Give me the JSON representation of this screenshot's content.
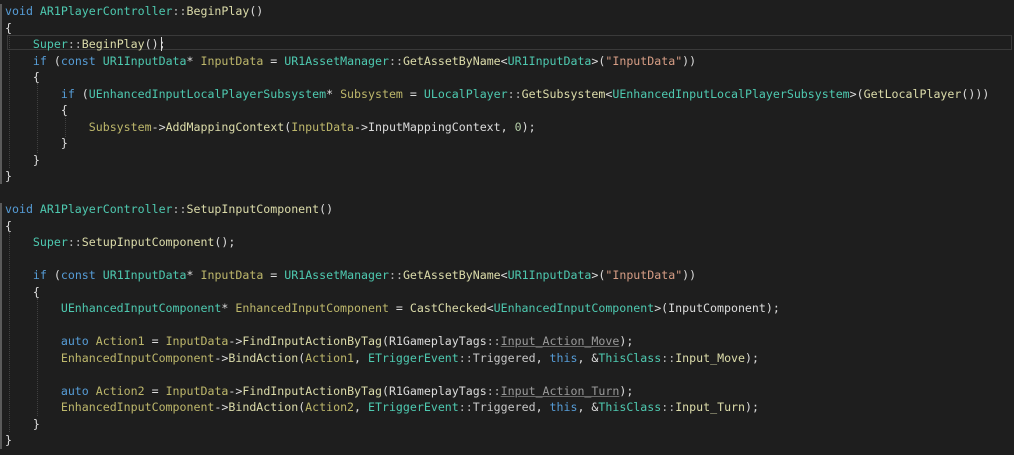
{
  "editor": {
    "lines": [
      [
        {
          "t": "void ",
          "c": "kw"
        },
        {
          "t": "AR1PlayerController",
          "c": "ty"
        },
        {
          "t": "::",
          "c": "op"
        },
        {
          "t": "BeginPlay",
          "c": "fn"
        },
        {
          "t": "()",
          "c": "tx"
        }
      ],
      [
        {
          "t": "{",
          "c": "tx"
        }
      ],
      [
        {
          "t": "    ",
          "c": "tx"
        },
        {
          "t": "Super",
          "c": "ty"
        },
        {
          "t": "::",
          "c": "op"
        },
        {
          "t": "BeginPlay",
          "c": "fn"
        },
        {
          "t": "();",
          "c": "tx"
        }
      ],
      [
        {
          "t": "    ",
          "c": "tx"
        },
        {
          "t": "if",
          "c": "kw"
        },
        {
          "t": " (",
          "c": "tx"
        },
        {
          "t": "const ",
          "c": "kw"
        },
        {
          "t": "UR1InputData",
          "c": "ty"
        },
        {
          "t": "* ",
          "c": "tx"
        },
        {
          "t": "InputData",
          "c": "ps"
        },
        {
          "t": " = ",
          "c": "tx"
        },
        {
          "t": "UR1AssetManager",
          "c": "ty"
        },
        {
          "t": "::",
          "c": "op"
        },
        {
          "t": "GetAssetByName",
          "c": "fn"
        },
        {
          "t": "<",
          "c": "tx"
        },
        {
          "t": "UR1InputData",
          "c": "ty"
        },
        {
          "t": ">(",
          "c": "tx"
        },
        {
          "t": "\"InputData\"",
          "c": "st"
        },
        {
          "t": "))",
          "c": "tx"
        }
      ],
      [
        {
          "t": "    {",
          "c": "tx"
        }
      ],
      [
        {
          "t": "        ",
          "c": "tx"
        },
        {
          "t": "if",
          "c": "kw"
        },
        {
          "t": " (",
          "c": "tx"
        },
        {
          "t": "UEnhancedInputLocalPlayerSubsystem",
          "c": "ty"
        },
        {
          "t": "* ",
          "c": "tx"
        },
        {
          "t": "Subsystem",
          "c": "ps"
        },
        {
          "t": " = ",
          "c": "tx"
        },
        {
          "t": "ULocalPlayer",
          "c": "ty"
        },
        {
          "t": "::",
          "c": "op"
        },
        {
          "t": "GetSubsystem",
          "c": "fn"
        },
        {
          "t": "<",
          "c": "tx"
        },
        {
          "t": "UEnhancedInputLocalPlayerSubsystem",
          "c": "ty"
        },
        {
          "t": ">(",
          "c": "tx"
        },
        {
          "t": "GetLocalPlayer",
          "c": "fn"
        },
        {
          "t": "()))",
          "c": "tx"
        }
      ],
      [
        {
          "t": "        {",
          "c": "tx"
        }
      ],
      [
        {
          "t": "            ",
          "c": "tx"
        },
        {
          "t": "Subsystem",
          "c": "ps"
        },
        {
          "t": "->",
          "c": "tx"
        },
        {
          "t": "AddMappingContext",
          "c": "fn"
        },
        {
          "t": "(",
          "c": "tx"
        },
        {
          "t": "InputData",
          "c": "ps"
        },
        {
          "t": "->",
          "c": "tx"
        },
        {
          "t": "InputMappingContext",
          "c": "tx"
        },
        {
          "t": ", ",
          "c": "tx"
        },
        {
          "t": "0",
          "c": "nm"
        },
        {
          "t": ");",
          "c": "tx"
        }
      ],
      [
        {
          "t": "        }",
          "c": "tx"
        }
      ],
      [
        {
          "t": "    }",
          "c": "tx"
        }
      ],
      [
        {
          "t": "}",
          "c": "tx"
        }
      ],
      [],
      [
        {
          "t": "void ",
          "c": "kw"
        },
        {
          "t": "AR1PlayerController",
          "c": "ty"
        },
        {
          "t": "::",
          "c": "op"
        },
        {
          "t": "SetupInputComponent",
          "c": "fn"
        },
        {
          "t": "()",
          "c": "tx"
        }
      ],
      [
        {
          "t": "{",
          "c": "tx"
        }
      ],
      [
        {
          "t": "    ",
          "c": "tx"
        },
        {
          "t": "Super",
          "c": "ty"
        },
        {
          "t": "::",
          "c": "op"
        },
        {
          "t": "SetupInputComponent",
          "c": "fn"
        },
        {
          "t": "();",
          "c": "tx"
        }
      ],
      [],
      [
        {
          "t": "    ",
          "c": "tx"
        },
        {
          "t": "if",
          "c": "kw"
        },
        {
          "t": " (",
          "c": "tx"
        },
        {
          "t": "const ",
          "c": "kw"
        },
        {
          "t": "UR1InputData",
          "c": "ty"
        },
        {
          "t": "* ",
          "c": "tx"
        },
        {
          "t": "InputData",
          "c": "ps"
        },
        {
          "t": " = ",
          "c": "tx"
        },
        {
          "t": "UR1AssetManager",
          "c": "ty"
        },
        {
          "t": "::",
          "c": "op"
        },
        {
          "t": "GetAssetByName",
          "c": "fn"
        },
        {
          "t": "<",
          "c": "tx"
        },
        {
          "t": "UR1InputData",
          "c": "ty"
        },
        {
          "t": ">(",
          "c": "tx"
        },
        {
          "t": "\"InputData\"",
          "c": "st"
        },
        {
          "t": "))",
          "c": "tx"
        }
      ],
      [
        {
          "t": "    {",
          "c": "tx"
        }
      ],
      [
        {
          "t": "        ",
          "c": "tx"
        },
        {
          "t": "UEnhancedInputComponent",
          "c": "ty"
        },
        {
          "t": "* ",
          "c": "tx"
        },
        {
          "t": "EnhancedInputComponent",
          "c": "ps"
        },
        {
          "t": " = ",
          "c": "tx"
        },
        {
          "t": "CastChecked",
          "c": "fn"
        },
        {
          "t": "<",
          "c": "tx"
        },
        {
          "t": "UEnhancedInputComponent",
          "c": "ty"
        },
        {
          "t": ">(",
          "c": "tx"
        },
        {
          "t": "InputComponent",
          "c": "tx"
        },
        {
          "t": ");",
          "c": "tx"
        }
      ],
      [],
      [
        {
          "t": "        ",
          "c": "tx"
        },
        {
          "t": "auto ",
          "c": "kw"
        },
        {
          "t": "Action1",
          "c": "ps"
        },
        {
          "t": " = ",
          "c": "tx"
        },
        {
          "t": "InputData",
          "c": "ps"
        },
        {
          "t": "->",
          "c": "tx"
        },
        {
          "t": "FindInputActionByTag",
          "c": "fn"
        },
        {
          "t": "(",
          "c": "tx"
        },
        {
          "t": "R1GameplayTags",
          "c": "tx"
        },
        {
          "t": "::",
          "c": "op"
        },
        {
          "t": "Input_Action_Move",
          "c": "pm",
          "u": true
        },
        {
          "t": ");",
          "c": "tx"
        }
      ],
      [
        {
          "t": "        ",
          "c": "tx"
        },
        {
          "t": "EnhancedInputComponent",
          "c": "ps"
        },
        {
          "t": "->",
          "c": "tx"
        },
        {
          "t": "BindAction",
          "c": "fn"
        },
        {
          "t": "(",
          "c": "tx"
        },
        {
          "t": "Action1",
          "c": "ps"
        },
        {
          "t": ", ",
          "c": "tx"
        },
        {
          "t": "ETriggerEvent",
          "c": "ty"
        },
        {
          "t": "::",
          "c": "op"
        },
        {
          "t": "Triggered",
          "c": "ev"
        },
        {
          "t": ", ",
          "c": "tx"
        },
        {
          "t": "this",
          "c": "kw"
        },
        {
          "t": ", &",
          "c": "tx"
        },
        {
          "t": "ThisClass",
          "c": "ty"
        },
        {
          "t": "::",
          "c": "op"
        },
        {
          "t": "Input_Move",
          "c": "fn"
        },
        {
          "t": ");",
          "c": "tx"
        }
      ],
      [],
      [
        {
          "t": "        ",
          "c": "tx"
        },
        {
          "t": "auto ",
          "c": "kw"
        },
        {
          "t": "Action2",
          "c": "ps"
        },
        {
          "t": " = ",
          "c": "tx"
        },
        {
          "t": "InputData",
          "c": "ps"
        },
        {
          "t": "->",
          "c": "tx"
        },
        {
          "t": "FindInputActionByTag",
          "c": "fn"
        },
        {
          "t": "(",
          "c": "tx"
        },
        {
          "t": "R1GameplayTags",
          "c": "tx"
        },
        {
          "t": "::",
          "c": "op"
        },
        {
          "t": "Input_Action_Turn",
          "c": "pm",
          "u": true
        },
        {
          "t": ");",
          "c": "tx"
        }
      ],
      [
        {
          "t": "        ",
          "c": "tx"
        },
        {
          "t": "EnhancedInputComponent",
          "c": "ps"
        },
        {
          "t": "->",
          "c": "tx"
        },
        {
          "t": "BindAction",
          "c": "fn"
        },
        {
          "t": "(",
          "c": "tx"
        },
        {
          "t": "Action2",
          "c": "ps"
        },
        {
          "t": ", ",
          "c": "tx"
        },
        {
          "t": "ETriggerEvent",
          "c": "ty"
        },
        {
          "t": "::",
          "c": "op"
        },
        {
          "t": "Triggered",
          "c": "ev"
        },
        {
          "t": ", ",
          "c": "tx"
        },
        {
          "t": "this",
          "c": "kw"
        },
        {
          "t": ", &",
          "c": "tx"
        },
        {
          "t": "ThisClass",
          "c": "ty"
        },
        {
          "t": "::",
          "c": "op"
        },
        {
          "t": "Input_Turn",
          "c": "fn"
        },
        {
          "t": ");",
          "c": "tx"
        }
      ],
      [
        {
          "t": "    }",
          "c": "tx"
        }
      ],
      [
        {
          "t": "}",
          "c": "tx"
        }
      ]
    ]
  },
  "colors": {
    "background": "#1e1e1e",
    "keyword": "#569cd6",
    "type": "#4ec9b0",
    "function": "#dcdcaa",
    "string": "#d69d85",
    "number": "#b5cea8",
    "text": "#dcdcdc",
    "local_variable": "#bdb76b"
  }
}
